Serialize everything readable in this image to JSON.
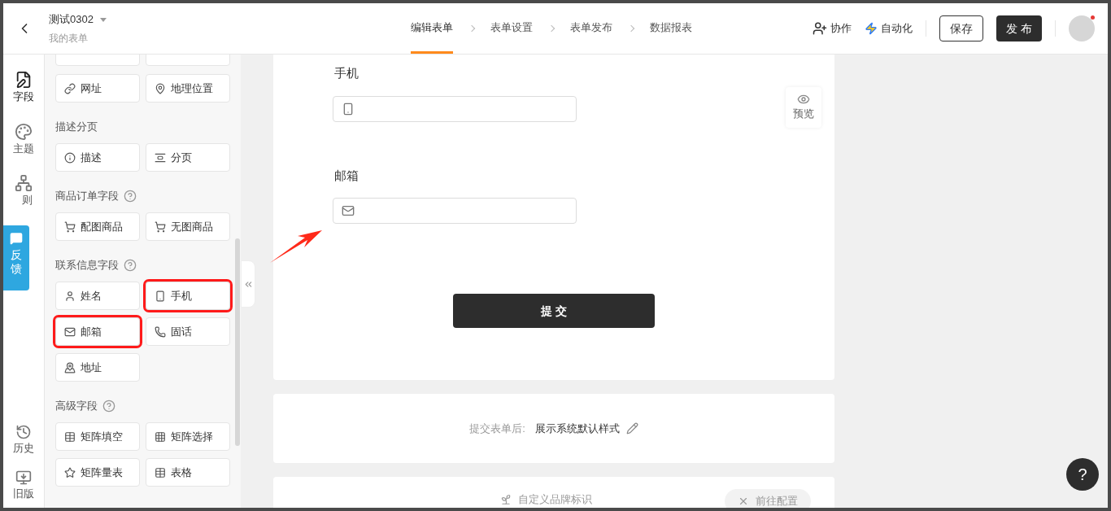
{
  "header": {
    "title": "测试0302",
    "subtitle": "我的表单",
    "steps": [
      {
        "label": "编辑表单",
        "selected": true
      },
      {
        "label": "表单设置",
        "selected": false
      },
      {
        "label": "表单发布",
        "selected": false
      },
      {
        "label": "数据报表",
        "selected": false
      }
    ],
    "collab": "协作",
    "automation": "自动化",
    "save": "保存",
    "publish": "发 布",
    "notification": true
  },
  "rail": {
    "items": [
      {
        "label": "字段",
        "selected": true
      },
      {
        "label": "主题",
        "selected": false
      },
      {
        "label": "则",
        "selected": false
      }
    ],
    "bottom": [
      {
        "label": "历史"
      },
      {
        "label": "旧版"
      }
    ],
    "feedback": "反馈"
  },
  "sections": [
    {
      "fields": [
        {
          "label": "网址",
          "highlighted": false
        },
        {
          "label": "地理位置",
          "highlighted": false
        }
      ]
    },
    {
      "title": "描述分页",
      "help": false,
      "fields": [
        {
          "label": "描述",
          "highlighted": false
        },
        {
          "label": "分页",
          "highlighted": false
        }
      ]
    },
    {
      "title": "商品订单字段",
      "help": true,
      "fields": [
        {
          "label": "配图商品",
          "highlighted": false
        },
        {
          "label": "无图商品",
          "highlighted": false
        }
      ]
    },
    {
      "title": "联系信息字段",
      "help": true,
      "fields": [
        {
          "label": "姓名",
          "highlighted": false
        },
        {
          "label": "手机",
          "highlighted": true
        },
        {
          "label": "邮箱",
          "highlighted": true
        },
        {
          "label": "固话",
          "highlighted": false
        },
        {
          "label": "地址",
          "highlighted": false
        }
      ]
    },
    {
      "title": "高级字段",
      "help": true,
      "fields": [
        {
          "label": "矩阵填空",
          "highlighted": false
        },
        {
          "label": "矩阵选择",
          "highlighted": false
        },
        {
          "label": "矩阵量表",
          "highlighted": false
        },
        {
          "label": "表格",
          "highlighted": false
        }
      ]
    }
  ],
  "form": {
    "fields": [
      {
        "label": "手机",
        "kind": "phone"
      },
      {
        "label": "邮箱",
        "kind": "email"
      }
    ],
    "submit": "提 交",
    "preview": "预览"
  },
  "after_submit": {
    "label": "提交表单后:",
    "value": "展示系统默认样式"
  },
  "brand": {
    "label": "自定义品牌标识",
    "action": "前往配置"
  },
  "help": "?"
}
